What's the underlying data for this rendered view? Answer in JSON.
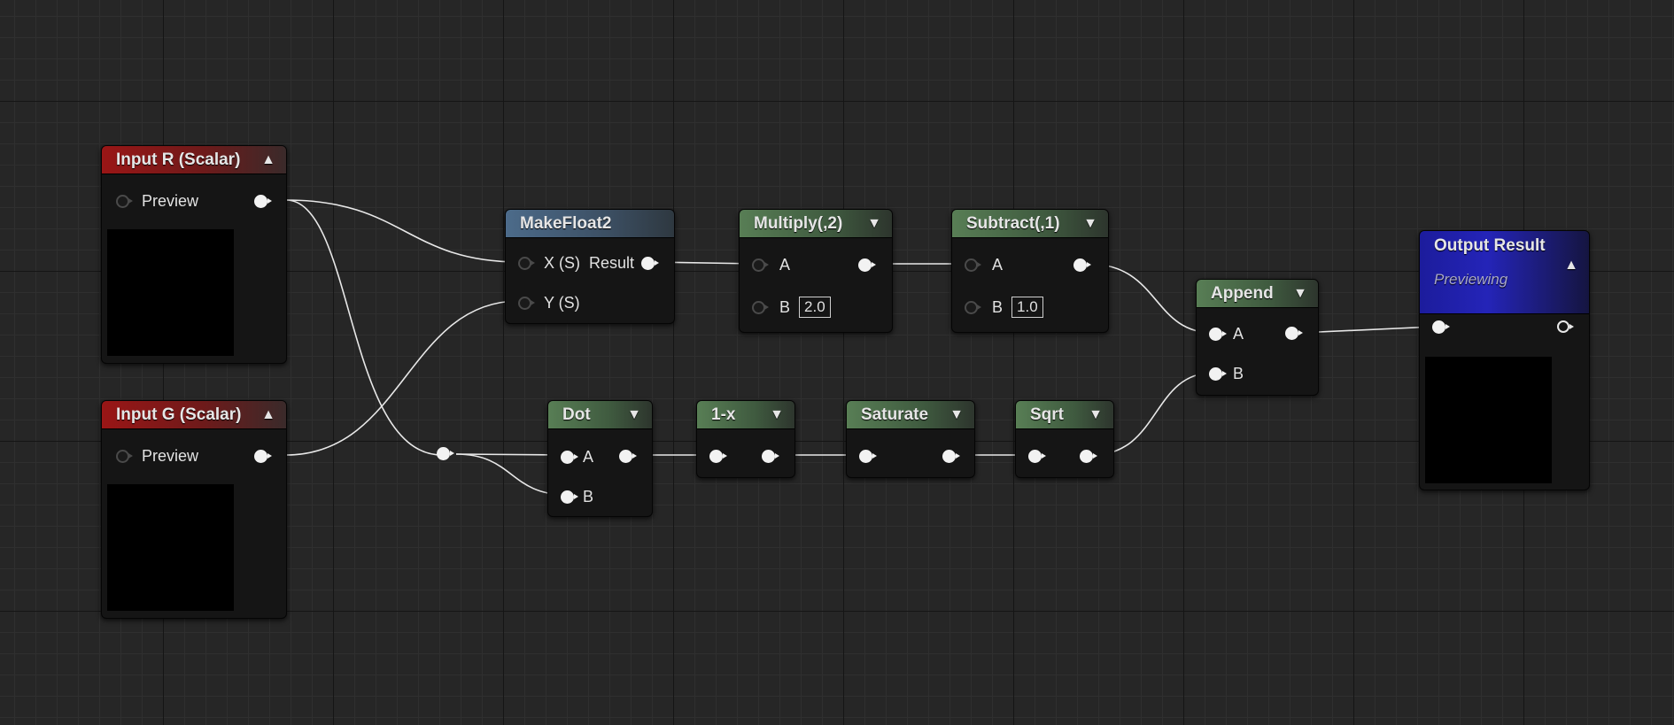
{
  "nodes": {
    "input_r": {
      "title": "Input R (Scalar)",
      "preview_label": "Preview",
      "accent": "#9a1616"
    },
    "input_g": {
      "title": "Input G (Scalar)",
      "preview_label": "Preview",
      "accent": "#9a1616"
    },
    "makefloat2": {
      "title": "MakeFloat2",
      "x_label": "X (S)",
      "y_label": "Y (S)",
      "result_label": "Result",
      "accent": "#4c6b8a"
    },
    "multiply": {
      "title": "Multiply(,2)",
      "a_label": "A",
      "b_label": "B",
      "b_value": "2.0",
      "accent": "#587e55"
    },
    "subtract": {
      "title": "Subtract(,1)",
      "a_label": "A",
      "b_label": "B",
      "b_value": "1.0",
      "accent": "#587e55"
    },
    "dot": {
      "title": "Dot",
      "a_label": "A",
      "b_label": "B",
      "accent": "#587e55"
    },
    "one_minus": {
      "title": "1-x",
      "accent": "#587e55"
    },
    "saturate": {
      "title": "Saturate",
      "accent": "#587e55"
    },
    "sqrt": {
      "title": "Sqrt",
      "accent": "#587e55"
    },
    "append": {
      "title": "Append",
      "a_label": "A",
      "b_label": "B",
      "accent": "#587e55"
    },
    "output": {
      "title": "Output Result",
      "subtitle": "Previewing",
      "accent": "#2424b8"
    }
  },
  "icons": {
    "collapse": "chevron-up-icon",
    "expand": "chevron-down-icon"
  }
}
